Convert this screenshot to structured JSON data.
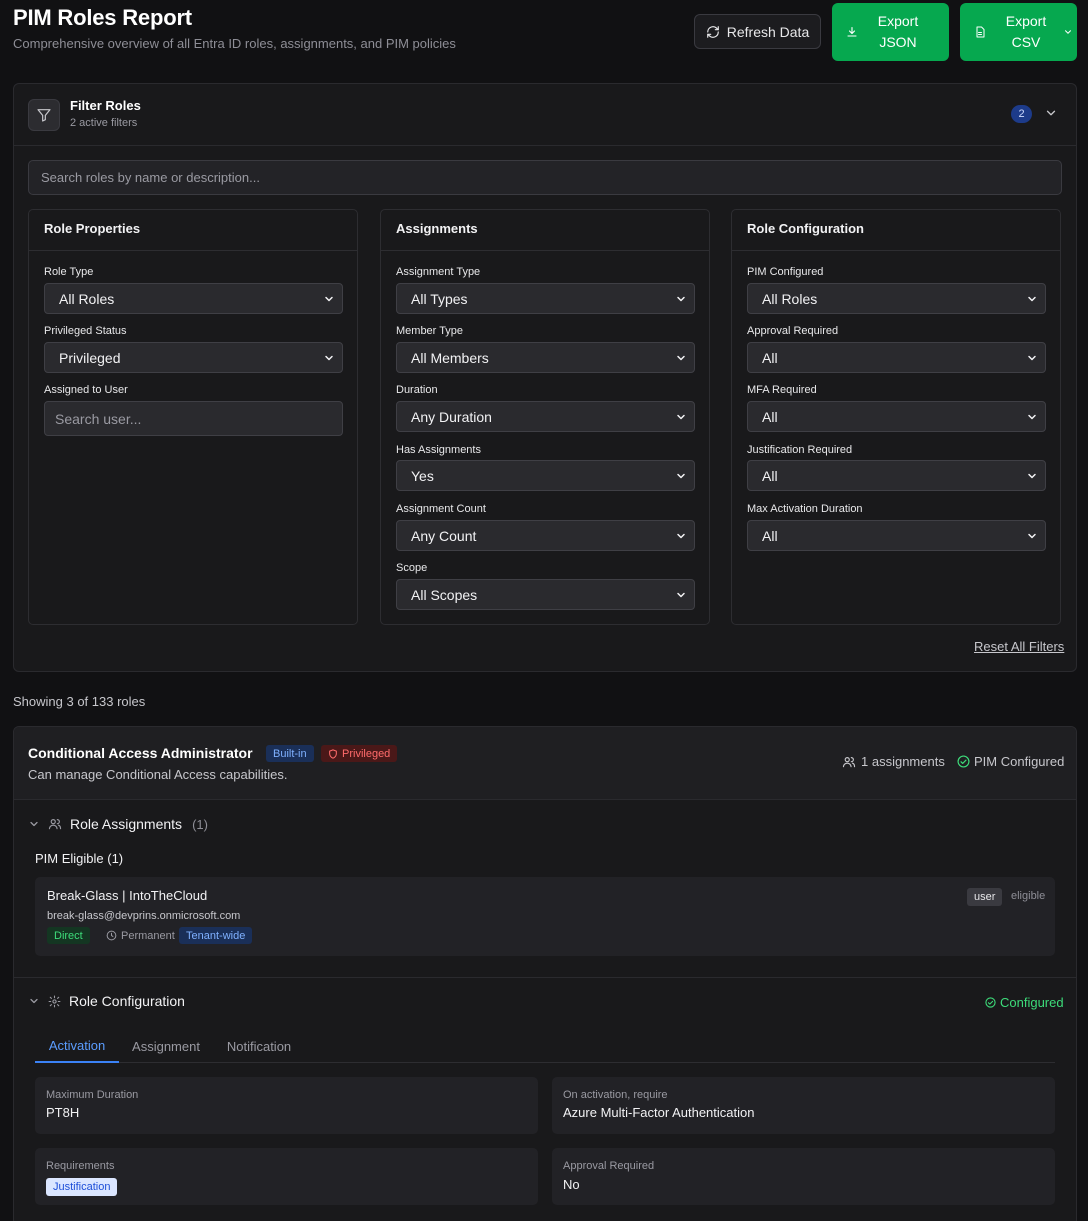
{
  "header": {
    "title": "PIM Roles Report",
    "subtitle": "Comprehensive overview of all Entra ID roles, assignments, and PIM policies",
    "refresh_label": "Refresh Data",
    "export_json_line1": "Export",
    "export_json_line2": "JSON",
    "export_csv_line1": "Export",
    "export_csv_line2": "CSV"
  },
  "filters": {
    "title": "Filter Roles",
    "active_text": "2 active filters",
    "active_count": "2",
    "search_placeholder": "Search roles by name or description...",
    "reset_label": "Reset All Filters",
    "role_properties": {
      "title": "Role Properties",
      "role_type_label": "Role Type",
      "role_type_value": "All Roles",
      "privileged_label": "Privileged Status",
      "privileged_value": "Privileged",
      "assigned_user_label": "Assigned to User",
      "assigned_user_placeholder": "Search user..."
    },
    "assignments": {
      "title": "Assignments",
      "assignment_type_label": "Assignment Type",
      "assignment_type_value": "All Types",
      "member_type_label": "Member Type",
      "member_type_value": "All Members",
      "duration_label": "Duration",
      "duration_value": "Any Duration",
      "has_assignments_label": "Has Assignments",
      "has_assignments_value": "Yes",
      "assignment_count_label": "Assignment Count",
      "assignment_count_value": "Any Count",
      "scope_label": "Scope",
      "scope_value": "All Scopes"
    },
    "role_configuration": {
      "title": "Role Configuration",
      "pim_configured_label": "PIM Configured",
      "pim_configured_value": "All Roles",
      "approval_label": "Approval Required",
      "approval_value": "All",
      "mfa_label": "MFA Required",
      "mfa_value": "All",
      "justification_label": "Justification Required",
      "justification_value": "All",
      "max_activation_label": "Max Activation Duration",
      "max_activation_value": "All"
    }
  },
  "results": {
    "showing_text": "Showing 3 of 133 roles"
  },
  "role": {
    "name": "Conditional Access Administrator",
    "builtin_tag": "Built-in",
    "privileged_tag": "Privileged",
    "description": "Can manage Conditional Access capabilities.",
    "assignments_meta": "1 assignments",
    "pim_meta": "PIM Configured",
    "assignments_section": {
      "title": "Role Assignments",
      "count": "(1)",
      "group_title": "PIM Eligible (1)",
      "item": {
        "name": "Break-Glass | IntoTheCloud",
        "email": "break-glass@devprins.onmicrosoft.com",
        "chip_direct": "Direct",
        "chip_permanent": "Permanent",
        "chip_scope": "Tenant-wide",
        "principal_type": "user",
        "state": "eligible"
      }
    },
    "config_section": {
      "title": "Role Configuration",
      "status": "Configured",
      "tabs": [
        "Activation",
        "Assignment",
        "Notification"
      ],
      "max_duration_label": "Maximum Duration",
      "max_duration_value": "PT8H",
      "on_activation_label": "On activation, require",
      "on_activation_value": "Azure Multi-Factor Authentication",
      "requirements_label": "Requirements",
      "requirements_chip": "Justification",
      "approval_label": "Approval Required",
      "approval_value": "No"
    }
  },
  "colors": {
    "background": "#111113",
    "panel": "#19191b",
    "accent_green": "#06a84f",
    "accent_blue": "#3b82f6",
    "privileged_red": "#ff6b6b",
    "status_green": "#3ddc7a"
  }
}
